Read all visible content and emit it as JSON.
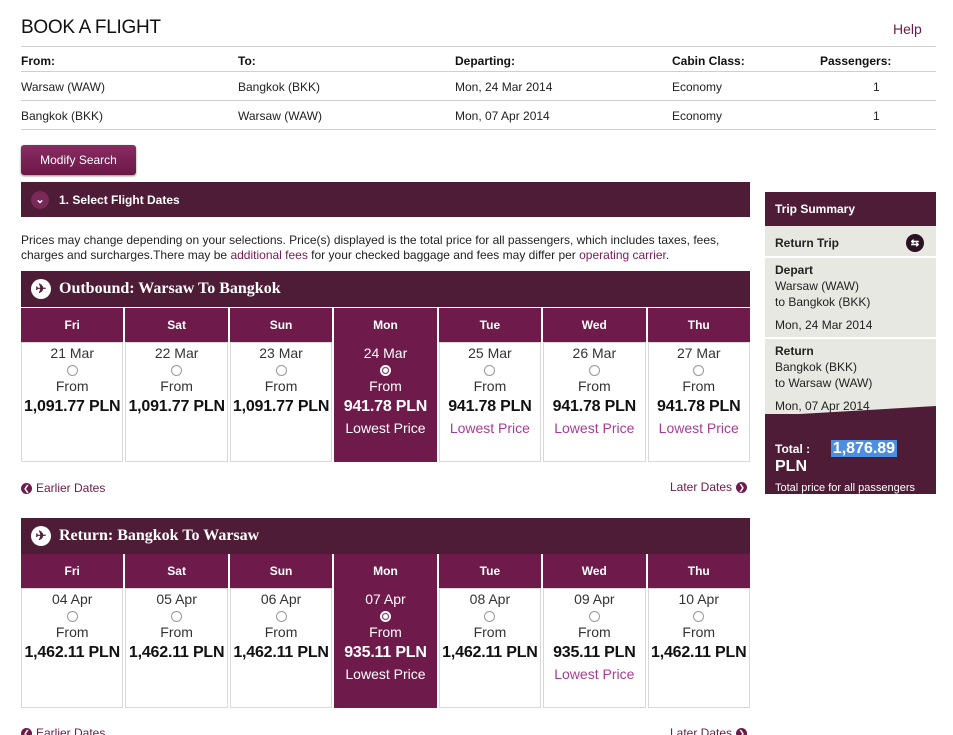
{
  "header": {
    "title": "BOOK A FLIGHT",
    "help": "Help"
  },
  "search": {
    "columns": [
      "From:",
      "To:",
      "Departing:",
      "Cabin Class:",
      "Passengers:"
    ],
    "rows": [
      [
        "Warsaw (WAW)",
        "Bangkok (BKK)",
        "Mon, 24 Mar 2014",
        "Economy",
        "1"
      ],
      [
        "Bangkok (BKK)",
        "Warsaw (WAW)",
        "Mon, 07 Apr 2014",
        "Economy",
        "1"
      ]
    ],
    "modify_label": "Modify Search"
  },
  "step": {
    "title": "1. Select Flight Dates"
  },
  "note": {
    "p1": "Prices may change depending on your selections. Price(s) displayed is the total price for all passengers, which includes taxes, fees, charges and surcharges.There may be ",
    "link1": "additional fees",
    "p2": " for your checked baggage and fees may differ per ",
    "link2": "operating carrier",
    "p3": "."
  },
  "outbound": {
    "title": "Outbound: Warsaw To Bangkok",
    "days": [
      {
        "dow": "Fri",
        "date": "21 Mar",
        "from": "From",
        "price": "1,091.77 PLN",
        "tag": ""
      },
      {
        "dow": "Sat",
        "date": "22 Mar",
        "from": "From",
        "price": "1,091.77 PLN",
        "tag": ""
      },
      {
        "dow": "Sun",
        "date": "23 Mar",
        "from": "From",
        "price": "1,091.77 PLN",
        "tag": ""
      },
      {
        "dow": "Mon",
        "date": "24 Mar",
        "from": "From",
        "price": "941.78 PLN",
        "tag": "Lowest Price"
      },
      {
        "dow": "Tue",
        "date": "25 Mar",
        "from": "From",
        "price": "941.78 PLN",
        "tag": "Lowest Price"
      },
      {
        "dow": "Wed",
        "date": "26 Mar",
        "from": "From",
        "price": "941.78 PLN",
        "tag": "Lowest Price"
      },
      {
        "dow": "Thu",
        "date": "27 Mar",
        "from": "From",
        "price": "941.78 PLN",
        "tag": "Lowest Price"
      }
    ],
    "selected": 3,
    "earlier": "Earlier Dates",
    "later": "Later Dates"
  },
  "return": {
    "title": "Return: Bangkok To Warsaw",
    "days": [
      {
        "dow": "Fri",
        "date": "04 Apr",
        "from": "From",
        "price": "1,462.11 PLN",
        "tag": ""
      },
      {
        "dow": "Sat",
        "date": "05 Apr",
        "from": "From",
        "price": "1,462.11 PLN",
        "tag": ""
      },
      {
        "dow": "Sun",
        "date": "06 Apr",
        "from": "From",
        "price": "1,462.11 PLN",
        "tag": ""
      },
      {
        "dow": "Mon",
        "date": "07 Apr",
        "from": "From",
        "price": "935.11 PLN",
        "tag": "Lowest Price"
      },
      {
        "dow": "Tue",
        "date": "08 Apr",
        "from": "From",
        "price": "1,462.11 PLN",
        "tag": ""
      },
      {
        "dow": "Wed",
        "date": "09 Apr",
        "from": "From",
        "price": "935.11 PLN",
        "tag": "Lowest Price"
      },
      {
        "dow": "Thu",
        "date": "10 Apr",
        "from": "From",
        "price": "1,462.11 PLN",
        "tag": ""
      }
    ],
    "selected": 3,
    "earlier": "Earlier Dates",
    "later": "Later Dates"
  },
  "summary": {
    "title": "Trip Summary",
    "trip_type": "Return Trip",
    "depart": {
      "label": "Depart",
      "from": "Warsaw (WAW)",
      "to": "to Bangkok (BKK)",
      "date": "Mon, 24 Mar 2014"
    },
    "ret": {
      "label": "Return",
      "from": "Bangkok (BKK)",
      "to": "to Warsaw (WAW)",
      "date": "Mon, 07 Apr 2014"
    },
    "total_label": "Total :",
    "total_amount": "1,876.89",
    "currency": "PLN",
    "total_note": "Total price for all passengers"
  },
  "colors": {
    "brand": "#4e1c36",
    "accent": "#6e1a4b",
    "link": "#a83c94",
    "highlight": "#4c8fe0"
  }
}
